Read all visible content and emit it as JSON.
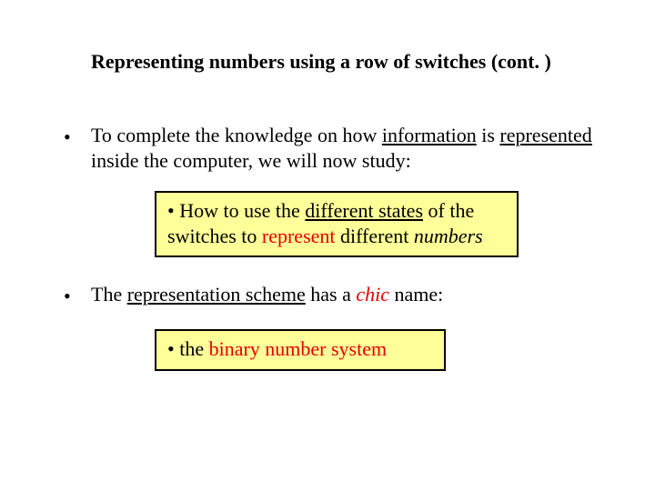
{
  "title": "Representing numbers using a row of switches (cont. )",
  "p1": {
    "pre": "To complete the knowledge on how ",
    "u1": "information",
    "mid": " is ",
    "u2": "represented",
    "post": " inside the computer, we will now study:"
  },
  "callout1": {
    "bullet": "•",
    "t1": "How to use the ",
    "u1": "different states",
    "t2": " of the switches to ",
    "r1": "represent",
    "t3": " different ",
    "i1": "numbers"
  },
  "p2": {
    "t1": "The ",
    "u1": "representation scheme",
    "t2": " has a ",
    "i1": "chic",
    "t3": " name:"
  },
  "callout2": {
    "bullet": "•",
    "t1": "the ",
    "r1": "binary number system"
  },
  "bullet": "•"
}
